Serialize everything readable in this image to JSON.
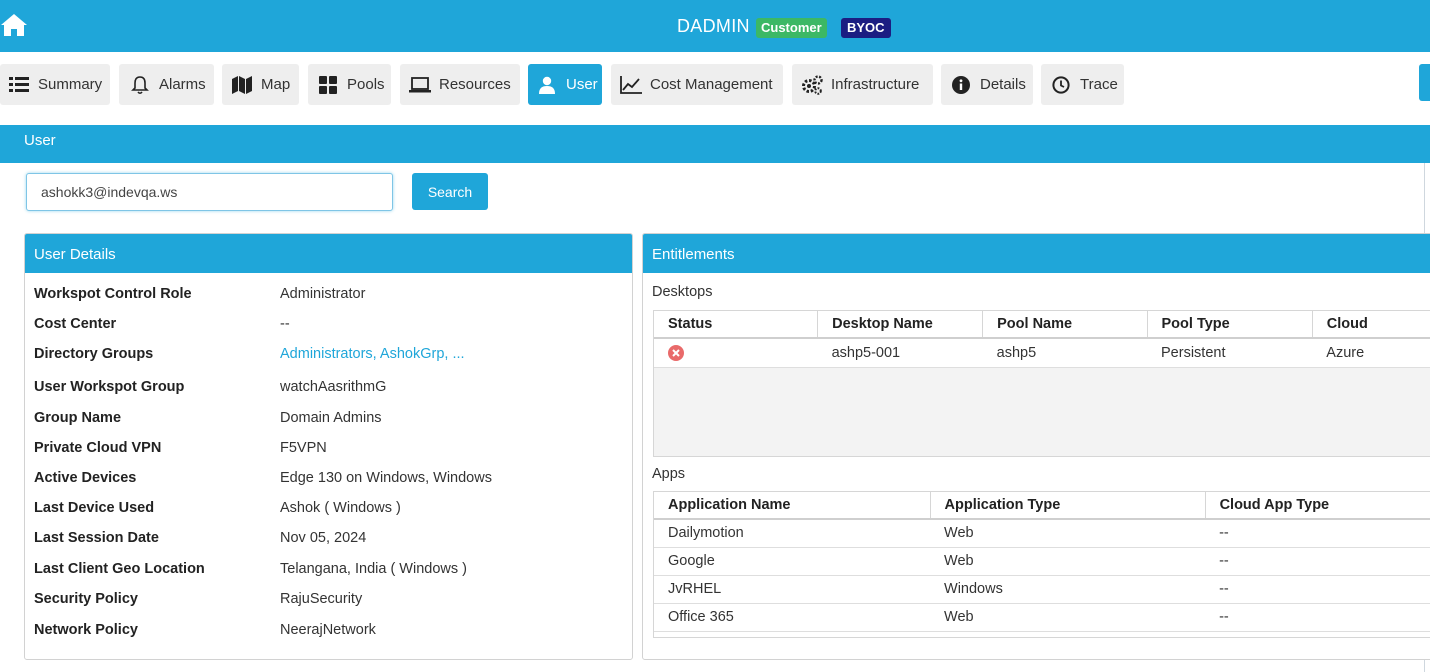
{
  "header": {
    "title": "DADMIN",
    "badge_customer": "Customer",
    "badge_byoc": "BYOC"
  },
  "tabs": [
    {
      "label": "Summary",
      "icon": "list-icon"
    },
    {
      "label": "Alarms",
      "icon": "bell-icon"
    },
    {
      "label": "Map",
      "icon": "map-icon"
    },
    {
      "label": "Pools",
      "icon": "grid-icon"
    },
    {
      "label": "Resources",
      "icon": "laptop-icon"
    },
    {
      "label": "User",
      "icon": "user-icon",
      "active": true
    },
    {
      "label": "Cost Management",
      "icon": "line-chart-icon"
    },
    {
      "label": "Infrastructure",
      "icon": "gears-icon"
    },
    {
      "label": "Details",
      "icon": "info-icon"
    },
    {
      "label": "Trace",
      "icon": "clock-icon"
    }
  ],
  "section": {
    "title": "User"
  },
  "search": {
    "value": "ashokk3@indevqa.ws",
    "button": "Search"
  },
  "user_details": {
    "title": "User Details",
    "rows": [
      {
        "label": "Workspot Control Role",
        "value": "Administrator"
      },
      {
        "label": "Cost Center",
        "value": "--"
      },
      {
        "label": "Directory Groups",
        "value": "Administrators, AshokGrp, ..."
      },
      {
        "label": "User Workspot Group",
        "value": "watchAasrithmG"
      },
      {
        "label": "Group Name",
        "value": "Domain Admins"
      },
      {
        "label": "Private Cloud VPN",
        "value": "F5VPN"
      },
      {
        "label": "Active Devices",
        "value": "Edge 130 on Windows, Windows"
      },
      {
        "label": "Last Device Used",
        "value": "Ashok ( Windows )"
      },
      {
        "label": "Last Session Date",
        "value": "Nov 05, 2024"
      },
      {
        "label": "Last Client Geo Location",
        "value": "Telangana, India ( Windows )"
      },
      {
        "label": "Security Policy",
        "value": "RajuSecurity"
      },
      {
        "label": "Network Policy",
        "value": "NeerajNetwork"
      }
    ]
  },
  "entitlements": {
    "title": "Entitlements",
    "desktops_label": "Desktops",
    "desktop_columns": [
      "Status",
      "Desktop Name",
      "Pool Name",
      "Pool Type",
      "Cloud"
    ],
    "desktops": [
      {
        "status": "error",
        "desktop_name": "ashp5-001",
        "pool_name": "ashp5",
        "pool_type": "Persistent",
        "cloud": "Azure"
      }
    ],
    "apps_label": "Apps",
    "app_columns": [
      "Application Name",
      "Application Type",
      "Cloud App Type"
    ],
    "apps": [
      {
        "name": "Dailymotion",
        "type": "Web",
        "cloud_type": "--"
      },
      {
        "name": "Google",
        "type": "Web",
        "cloud_type": "--"
      },
      {
        "name": "JvRHEL",
        "type": "Windows",
        "cloud_type": "--"
      },
      {
        "name": "Office 365",
        "type": "Web",
        "cloud_type": "--"
      }
    ]
  },
  "colors": {
    "accent": "#1fa6d9",
    "customer_badge": "#3cb865",
    "byoc_badge": "#1b1d82",
    "error": "#e96a6a"
  }
}
